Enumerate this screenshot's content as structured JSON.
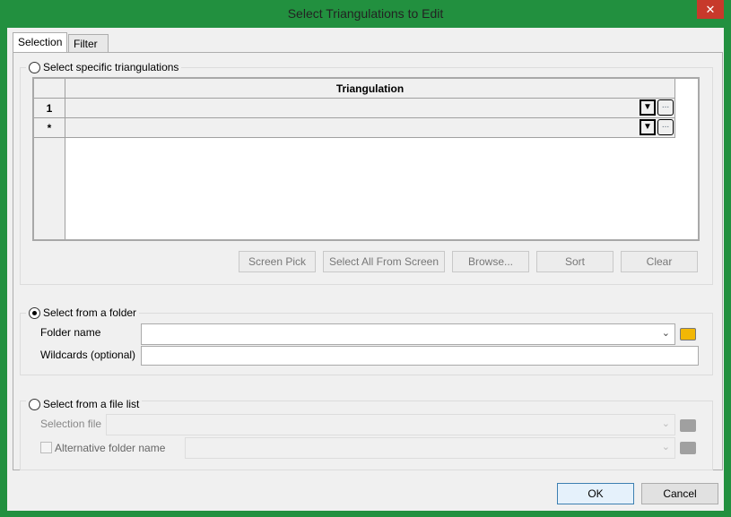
{
  "window": {
    "title": "Select Triangulations to Edit",
    "close_label": "✕"
  },
  "tabs": [
    {
      "label": "Selection"
    },
    {
      "label": "Filter"
    }
  ],
  "specific": {
    "label": "Select specific triangulations",
    "column_header": "Triangulation",
    "rows": [
      {
        "header": "1",
        "value": ""
      },
      {
        "header": "*",
        "value": ""
      }
    ],
    "dropdown_glyph": "▼",
    "ellipsis": "...",
    "buttons": [
      "Screen Pick",
      "Select All From Screen",
      "Browse...",
      "Sort",
      "Clear"
    ]
  },
  "folder": {
    "label": "Select from a folder",
    "selected": true,
    "folder_name_label": "Folder name",
    "folder_name_value": "",
    "wildcards_label": "Wildcards (optional)",
    "wildcards_value": ""
  },
  "filelist": {
    "label": "Select from a file list",
    "selected": false,
    "selection_file_label": "Selection file",
    "alt_folder_label": "Alternative folder name",
    "alt_folder_checked": false
  },
  "footer": {
    "ok": "OK",
    "cancel": "Cancel"
  }
}
